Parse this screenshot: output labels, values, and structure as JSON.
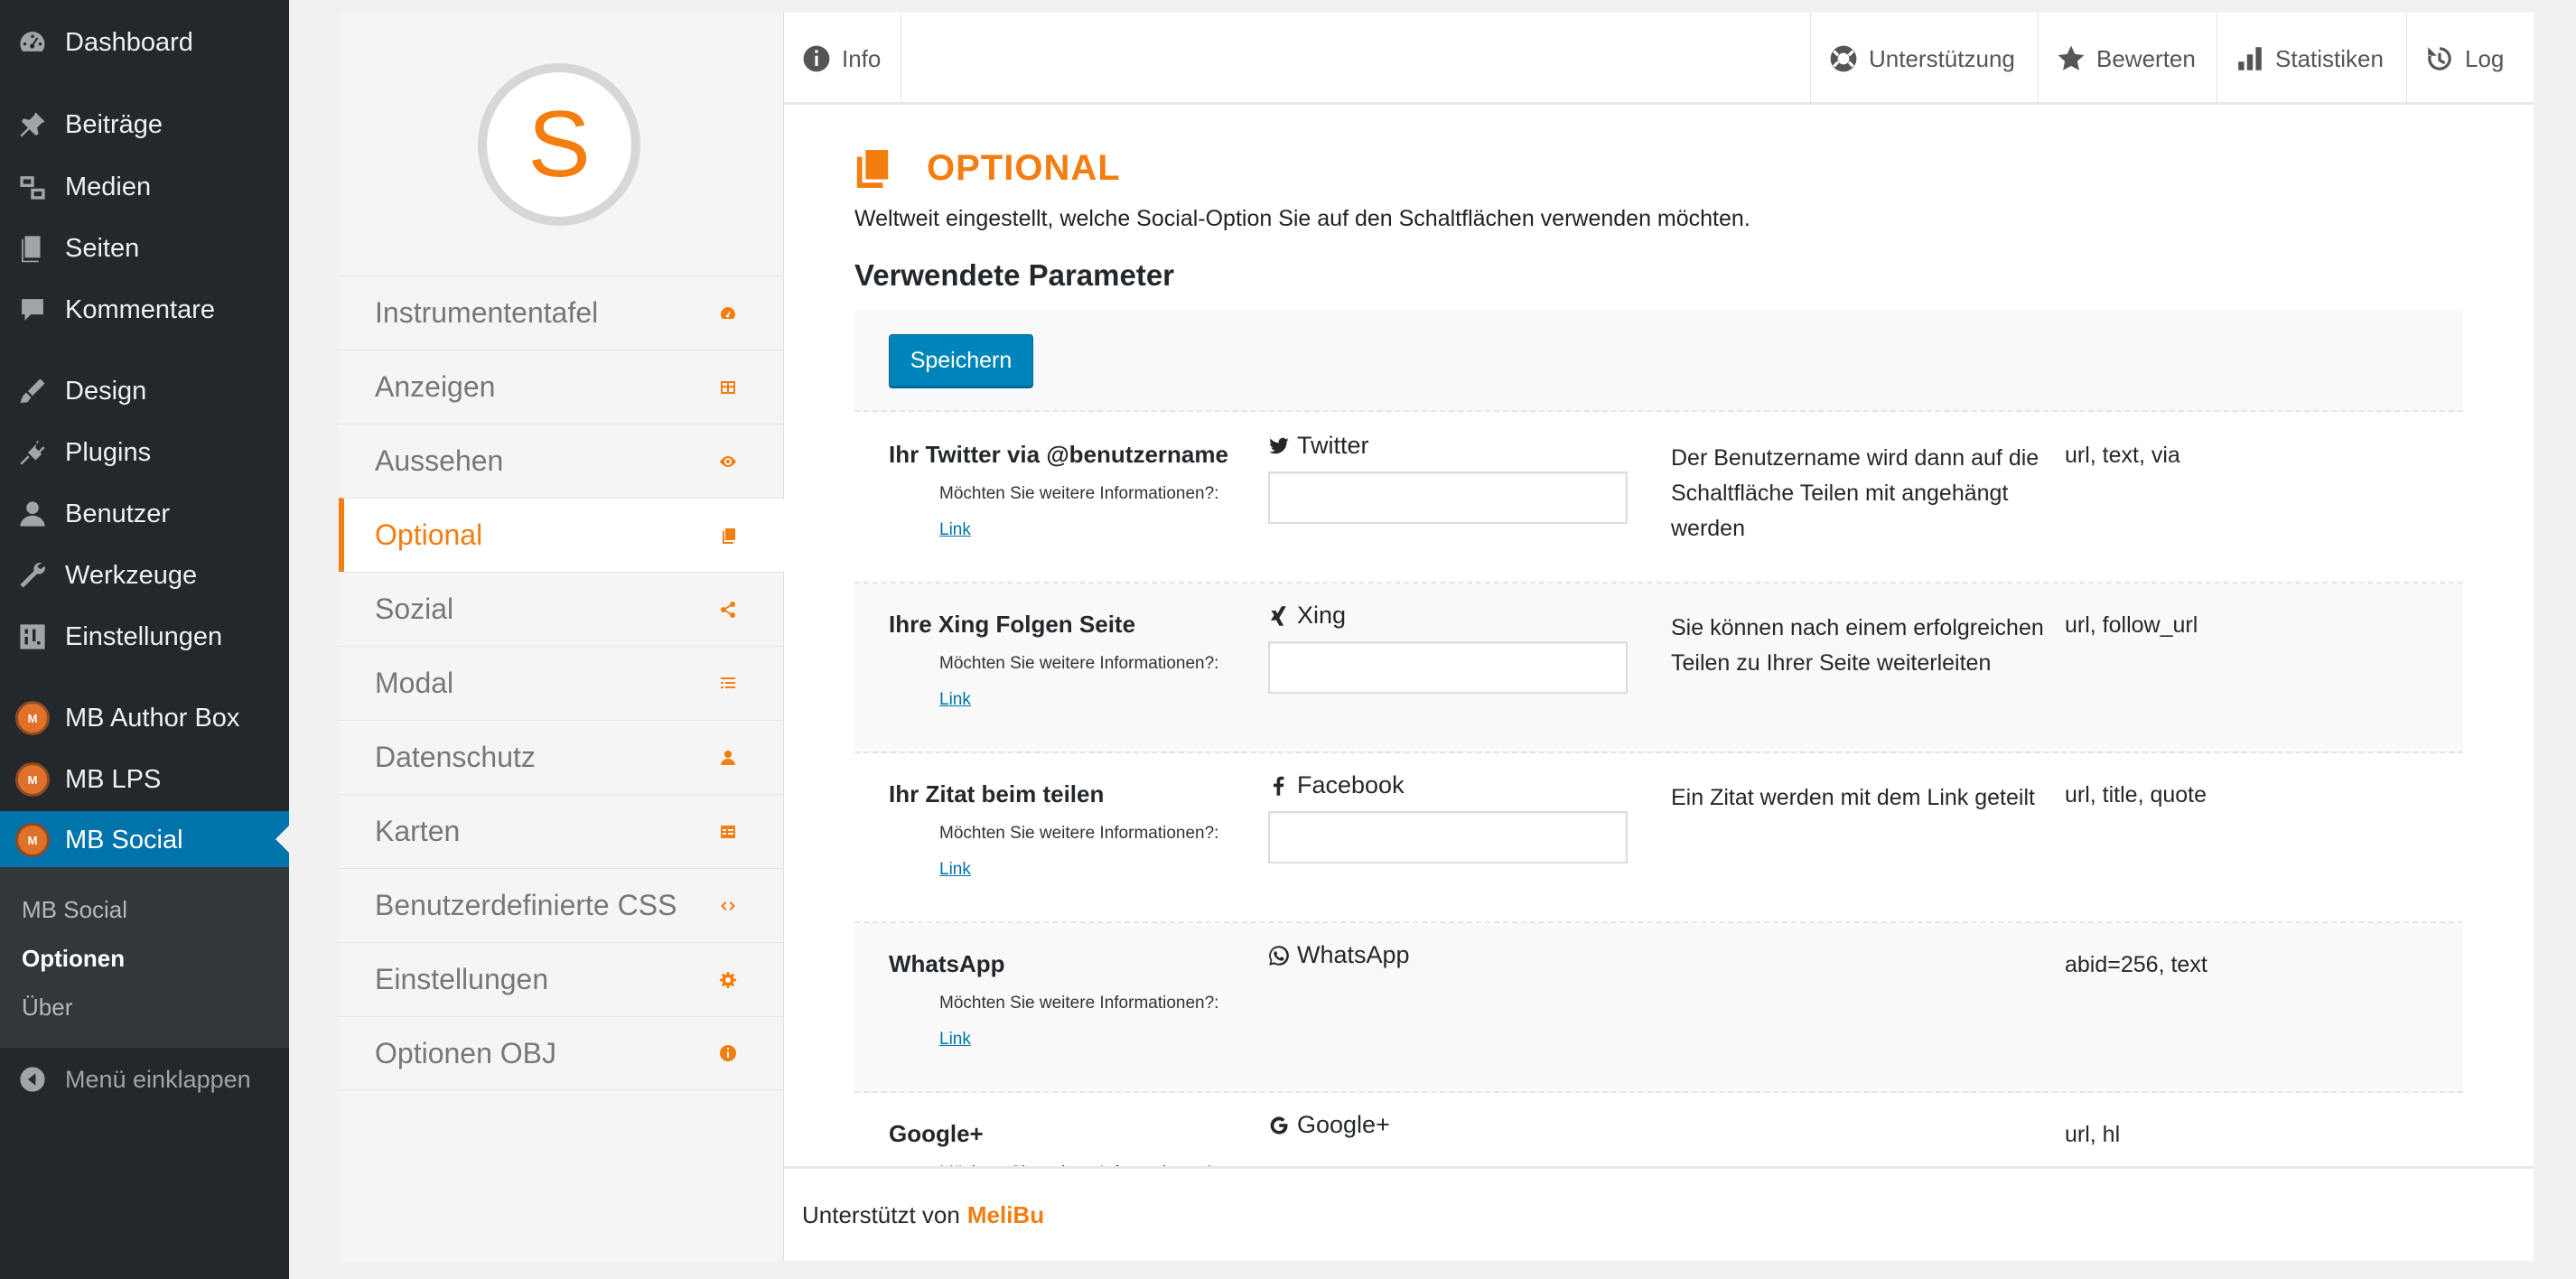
{
  "admin_menu": {
    "items": [
      {
        "label": "Dashboard",
        "icon": "dashboard-icon"
      },
      {
        "label": "Beiträge",
        "icon": "pin-icon"
      },
      {
        "label": "Medien",
        "icon": "media-icon"
      },
      {
        "label": "Seiten",
        "icon": "pages-icon"
      },
      {
        "label": "Kommentare",
        "icon": "comment-icon"
      },
      {
        "label": "Design",
        "icon": "brush-icon"
      },
      {
        "label": "Plugins",
        "icon": "plugin-icon"
      },
      {
        "label": "Benutzer",
        "icon": "user-icon"
      },
      {
        "label": "Werkzeuge",
        "icon": "wrench-icon"
      },
      {
        "label": "Einstellungen",
        "icon": "settings-icon"
      },
      {
        "label": "MB Author Box",
        "icon": "mb-logo-icon"
      },
      {
        "label": "MB LPS",
        "icon": "mb-logo-icon"
      },
      {
        "label": "MB Social",
        "icon": "mb-logo-icon"
      }
    ],
    "submenu": [
      "MB Social",
      "Optionen",
      "Über"
    ],
    "collapse_label": "Menü einklappen",
    "logo_text": "M"
  },
  "plugin": {
    "logo_letter": "S",
    "nav": [
      "Instrumententafel",
      "Anzeigen",
      "Aussehen",
      "Optional",
      "Sozial",
      "Modal",
      "Datenschutz",
      "Karten",
      "Benutzerdefinierte CSS",
      "Einstellungen",
      "Optionen OBJ"
    ],
    "active_nav": "Optional"
  },
  "tabs": {
    "info": "Info",
    "support": "Unterstützung",
    "rate": "Bewerten",
    "stats": "Statistiken",
    "log": "Log"
  },
  "content": {
    "title": "OPTIONAL",
    "description": "Weltweit eingestellt, welche Social-Option Sie auf den Schaltflächen verwenden möchten.",
    "section_title": "Verwendete Parameter",
    "save_label": "Speichern",
    "more_info": "Möchten Sie weitere Informationen?:",
    "link_label": "Link",
    "rows": [
      {
        "label": "Ihr Twitter via @benutzername",
        "network": "Twitter",
        "network_icon": "twitter-icon",
        "has_input": true,
        "description": "Der Benutzername wird dann auf die Schaltfläche Teilen mit angehängt werden",
        "params": "url, text, via"
      },
      {
        "label": "Ihre Xing Folgen Seite",
        "network": "Xing",
        "network_icon": "xing-icon",
        "has_input": true,
        "description": "Sie können nach einem erfolgreichen Teilen zu Ihrer Seite weiterleiten",
        "params": "url, follow_url"
      },
      {
        "label": "Ihr Zitat beim teilen",
        "network": "Facebook",
        "network_icon": "facebook-icon",
        "has_input": true,
        "description": "Ein Zitat werden mit dem Link geteilt",
        "params": "url, title, quote"
      },
      {
        "label": "WhatsApp",
        "network": "WhatsApp",
        "network_icon": "whatsapp-icon",
        "has_input": false,
        "description": "",
        "params": "abid=256, text"
      },
      {
        "label": "Google+",
        "network": "Google+",
        "network_icon": "google-icon",
        "has_input": false,
        "description": "",
        "params": "url, hl"
      }
    ]
  },
  "footer": {
    "prefix": "Unterstützt von",
    "brand": "MeliBu"
  },
  "colors": {
    "accent": "#f47d10",
    "wp_blue": "#0073aa",
    "admin_bg": "#23282d"
  }
}
